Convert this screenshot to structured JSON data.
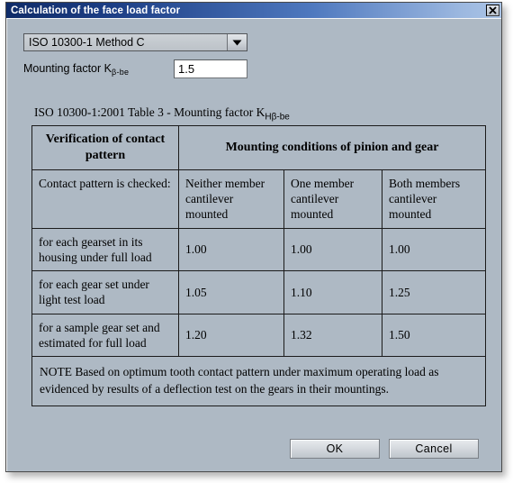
{
  "window": {
    "title": "Calculation of the face load factor",
    "close_icon": "close-icon"
  },
  "form": {
    "method_select": {
      "selected": "ISO 10300-1 Method C",
      "arrow_icon": "chevron-down-icon"
    },
    "mounting_factor": {
      "label_main": "Mounting factor K",
      "label_sub": "β-be",
      "value": "1.5"
    }
  },
  "table_caption": {
    "main": "ISO 10300-1:2001 Table 3 - Mounting factor K",
    "sub": "Hβ-be"
  },
  "table": {
    "header": {
      "col_a": "Verification of contact pattern",
      "merged": "Mounting conditions of pinion and gear"
    },
    "subheader": {
      "col_a": "Contact pattern is checked:",
      "col_b": "Neither member cantilever mounted",
      "col_c": "One member cantilever mounted",
      "col_d": "Both members cantilever mounted"
    },
    "rows": [
      {
        "label": "for each gearset in its housing under full load",
        "neither": "1.00",
        "one": "1.00",
        "both": "1.00"
      },
      {
        "label": "for each gear set under light test load",
        "neither": "1.05",
        "one": "1.10",
        "both": "1.25"
      },
      {
        "label": "for a sample gear set and estimated for full load",
        "neither": "1.20",
        "one": "1.32",
        "both": "1.50"
      }
    ],
    "note": "NOTE   Based on optimum tooth contact pattern under maximum operating load as evidenced by results of a deflection test on the gears in their mountings."
  },
  "buttons": {
    "ok": "OK",
    "cancel": "Cancel"
  },
  "colors": {
    "dialog_background": "#aeb9c4",
    "title_bar_start": "#0f2b68",
    "title_bar_end": "#aac4e6",
    "input_background": "#ffffff",
    "border": "#1b1b1b"
  }
}
